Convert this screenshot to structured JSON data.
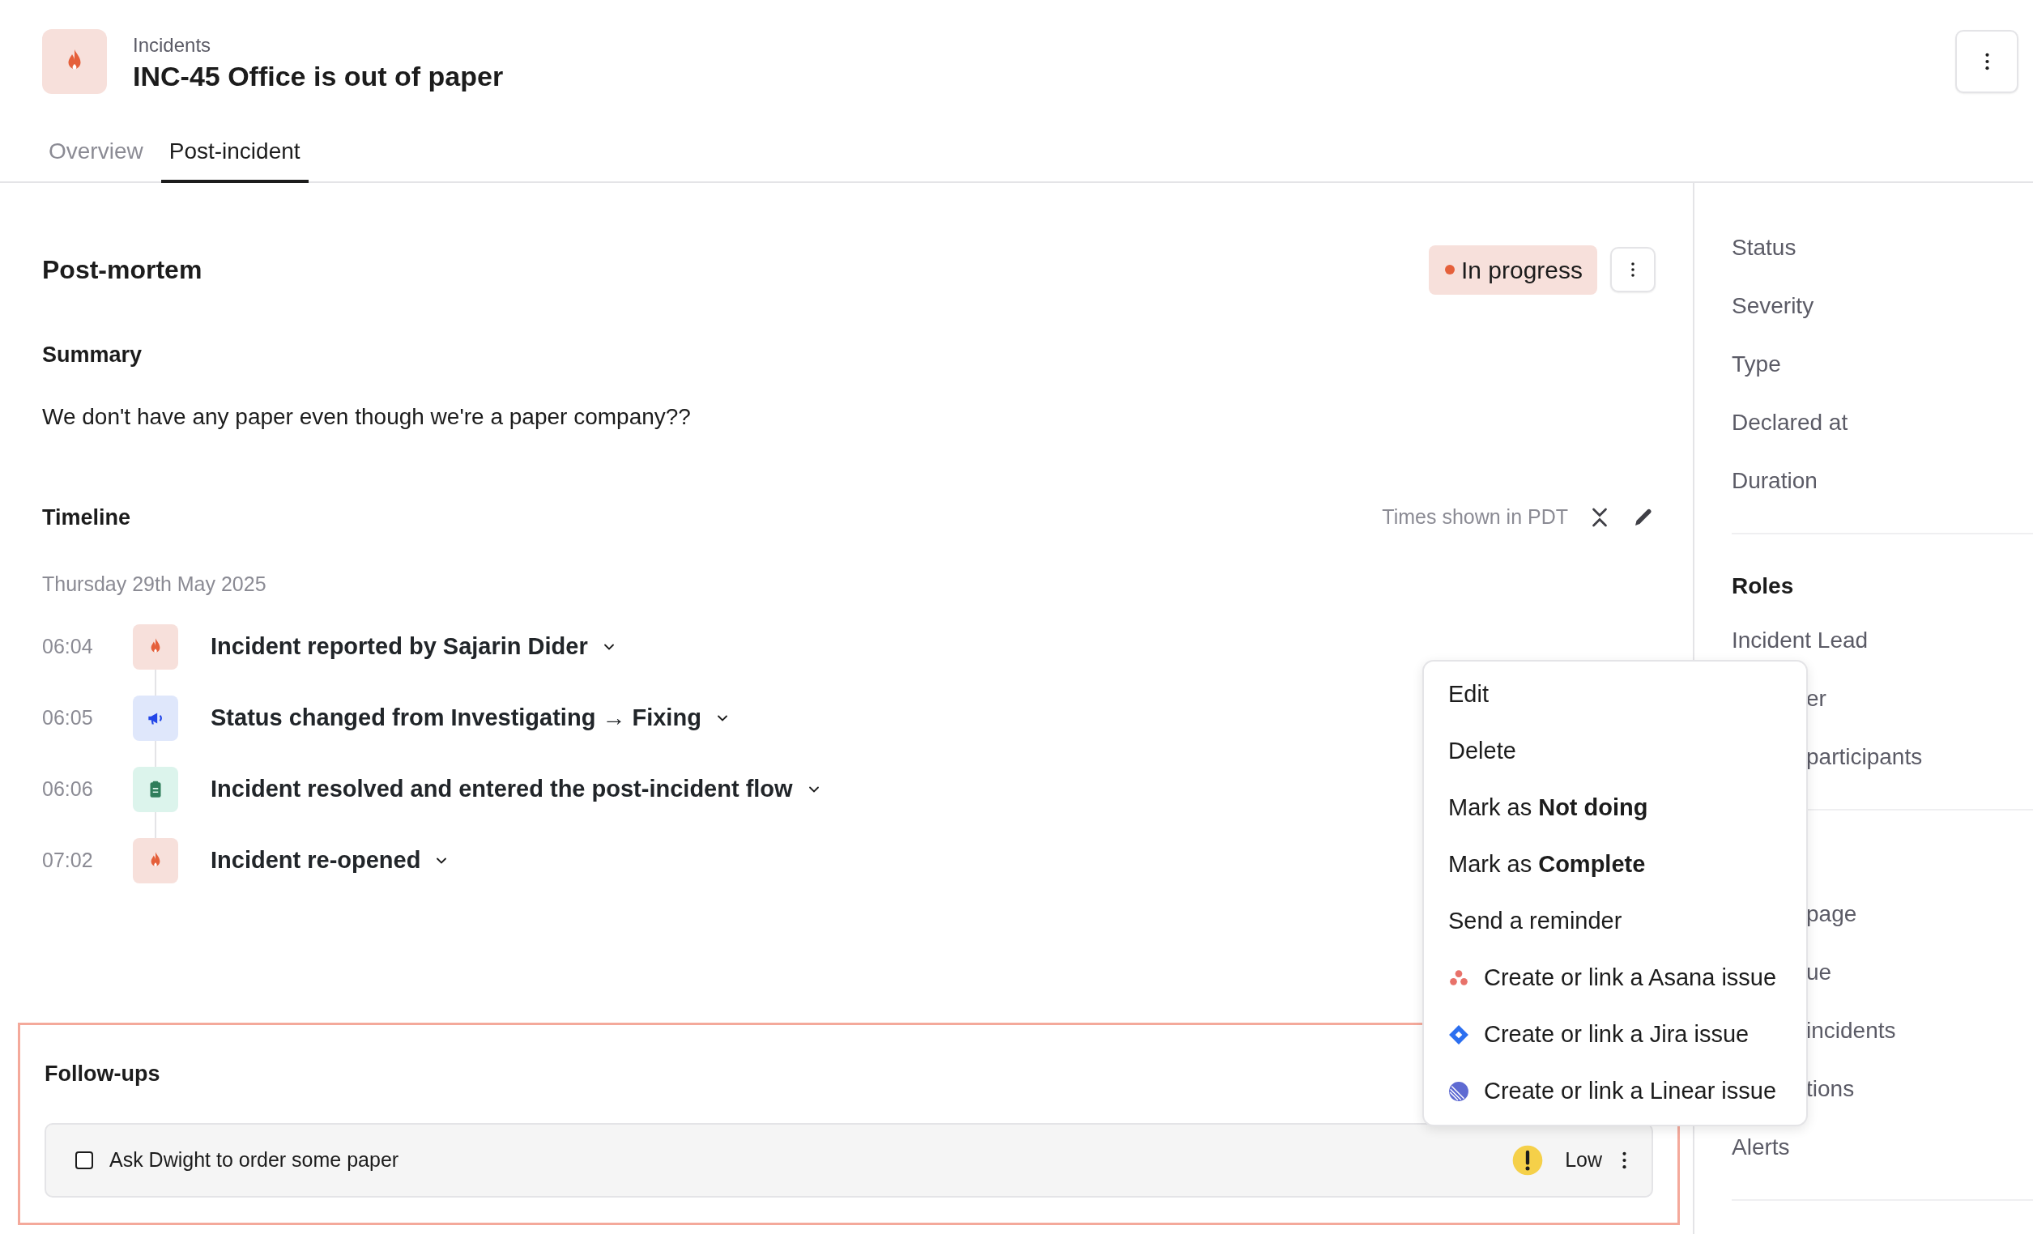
{
  "breadcrumb": "Incidents",
  "title": "INC-45 Office is out of paper",
  "tabs": [
    {
      "label": "Overview",
      "selected": false
    },
    {
      "label": "Post-incident",
      "selected": true
    }
  ],
  "postmortem": {
    "heading": "Post-mortem",
    "status": {
      "label": "In progress",
      "color": "#e5603b"
    }
  },
  "summary": {
    "heading": "Summary",
    "text": "We don't have any paper even though we're a paper company??"
  },
  "timeline": {
    "heading": "Timeline",
    "timezone_note": "Times shown in PDT",
    "date": "Thursday 29th May 2025",
    "events": [
      {
        "time": "06:04",
        "kind": "incident",
        "text": "Incident reported by Sajarin Dider"
      },
      {
        "time": "06:05",
        "kind": "status",
        "text": "Status changed from Investigating → Fixing"
      },
      {
        "time": "06:06",
        "kind": "resolved",
        "text": "Incident resolved and entered the post-incident flow"
      },
      {
        "time": "07:02",
        "kind": "incident",
        "text": "Incident re-opened"
      }
    ]
  },
  "follow_ups": {
    "heading": "Follow-ups",
    "items": [
      {
        "text": "Ask Dwight to order some paper",
        "checked": false,
        "priority": "Low"
      }
    ]
  },
  "menu": [
    {
      "kind": "plain",
      "text": "Edit"
    },
    {
      "kind": "plain",
      "text": "Delete"
    },
    {
      "kind": "plain",
      "text": "Mark as **Not doing**"
    },
    {
      "kind": "plain",
      "text": "Mark as **Complete**"
    },
    {
      "kind": "plain",
      "text": "Send a reminder"
    },
    {
      "kind": "asana",
      "text": "Create or link a Asana issue"
    },
    {
      "kind": "jira",
      "text": "Create or link a Jira issue"
    },
    {
      "kind": "linear",
      "text": "Create or link a Linear issue"
    }
  ],
  "sidebar": {
    "fields": [
      "Status",
      "Severity",
      "Type",
      "Declared at",
      "Duration"
    ],
    "roles": {
      "heading": "Roles",
      "items": [
        {
          "text": "Incident Lead",
          "clipped": false
        },
        {
          "text": "er",
          "clipped": true
        },
        {
          "text": "participants",
          "clipped": true
        }
      ]
    },
    "links": [
      {
        "text": "page",
        "clipped": true
      },
      {
        "text": "ue",
        "clipped": true
      },
      {
        "text": "incidents",
        "clipped": true
      },
      {
        "text": "tions",
        "clipped": true
      },
      {
        "text": "Alerts",
        "clipped": false
      }
    ]
  }
}
